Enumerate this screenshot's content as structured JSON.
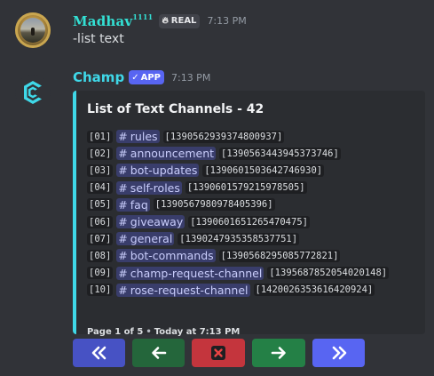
{
  "user_message": {
    "username": "Madhav",
    "username_suffix": "1111",
    "role_badge": "REAL",
    "timestamp": "7:13 PM",
    "text": "-list text"
  },
  "bot_message": {
    "bot_name": "Champ",
    "app_badge": "APP",
    "timestamp": "7:13 PM",
    "embed": {
      "accent_color": "#3fd8e8",
      "title": "List of Text Channels - 42",
      "channels": [
        {
          "index": "[01]",
          "name": "rules",
          "id": "[1390562939374800937]"
        },
        {
          "index": "[02]",
          "name": "announcement",
          "id": "[1390563443945373746]"
        },
        {
          "index": "[03]",
          "name": "bot-updates",
          "id": "[1390601503642746930]"
        },
        {
          "index": "[04]",
          "name": "self-roles",
          "id": "[1390601579215978505]"
        },
        {
          "index": "[05]",
          "name": "faq",
          "id": "[1390567980978405396]"
        },
        {
          "index": "[06]",
          "name": "giveaway",
          "id": "[1390601651265470475]"
        },
        {
          "index": "[07]",
          "name": "general",
          "id": "[1390247935358537751]"
        },
        {
          "index": "[08]",
          "name": "bot-commands",
          "id": "[1390568295085772821]"
        },
        {
          "index": "[09]",
          "name": "champ-request-channel",
          "id": "[1395687852054020148]"
        },
        {
          "index": "[10]",
          "name": "rose-request-channel",
          "id": "[1420026353616420924]"
        }
      ],
      "footer_page": "Page 1 of 5",
      "footer_sep": "•",
      "footer_time": "Today at 7:13 PM"
    },
    "buttons": [
      {
        "name": "first-page",
        "icon": "double-chevron-left-icon",
        "color": "#4752c4"
      },
      {
        "name": "previous-page",
        "icon": "arrow-left-icon",
        "color": "#24663b"
      },
      {
        "name": "stop",
        "icon": "close-icon",
        "color": "#c4353d"
      },
      {
        "name": "next-page",
        "icon": "arrow-right-icon",
        "color": "#248046"
      },
      {
        "name": "last-page",
        "icon": "double-chevron-right-icon",
        "color": "#5865f2"
      }
    ]
  }
}
